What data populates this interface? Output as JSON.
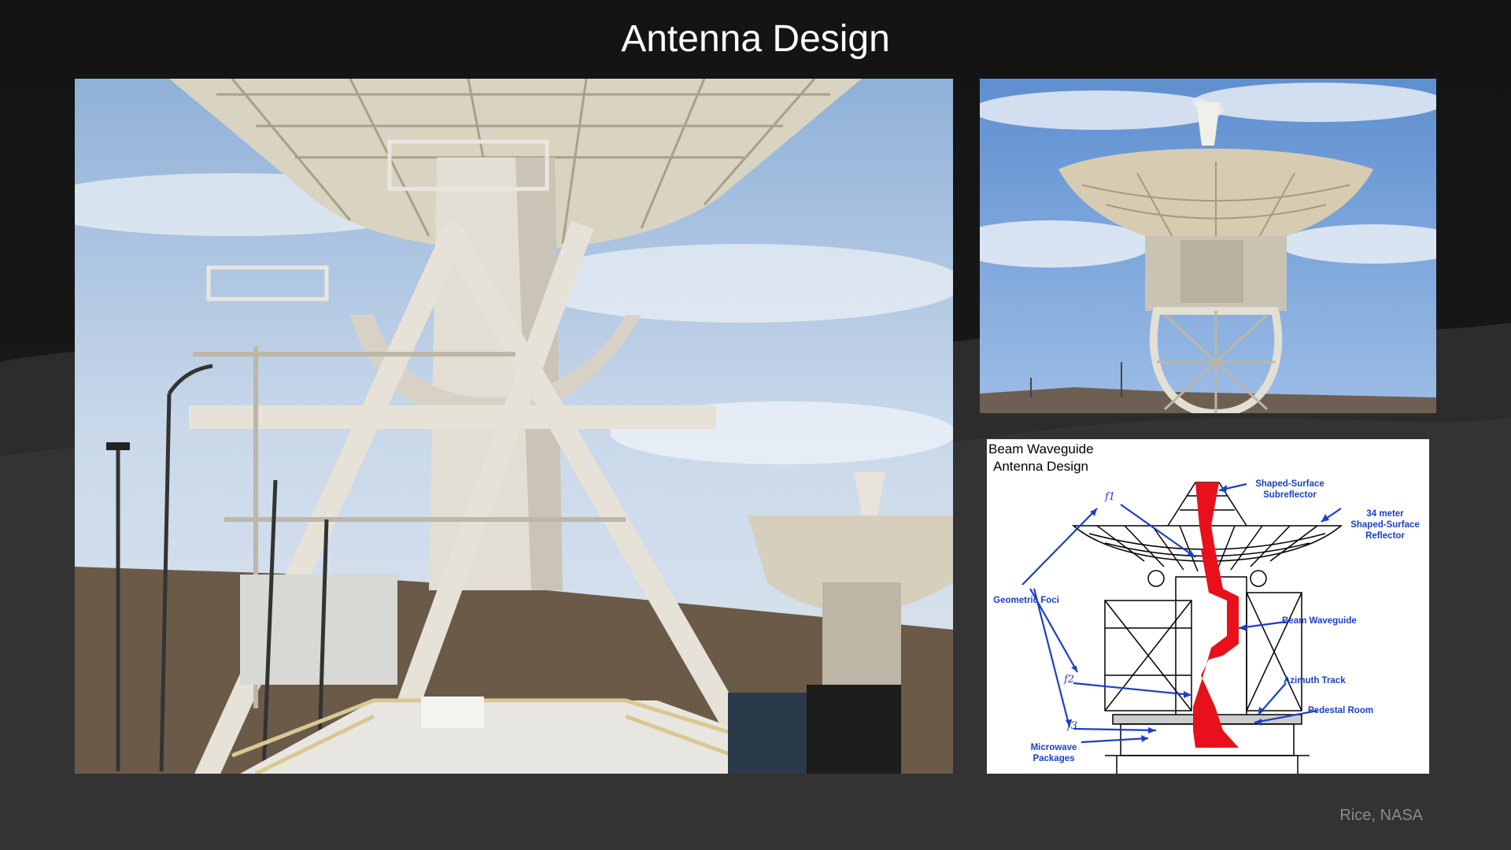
{
  "slide": {
    "title": "Antenna Design",
    "credit": "Rice, NASA"
  },
  "diagram": {
    "title_line1": "Beam Waveguide",
    "title_line2": "Antenna Design",
    "labels": {
      "subreflector_line1": "Shaped-Surface",
      "subreflector_line2": "Subreflector",
      "reflector_line1": "34 meter",
      "reflector_line2": "Shaped-Surface",
      "reflector_line3": "Reflector",
      "geometric_foci": "Geometric Foci",
      "beam_waveguide": "Beam Waveguide",
      "azimuth_track": "Azimuth Track",
      "pedestal_room": "Pedestal Room",
      "microwave_line1": "Microwave",
      "microwave_line2": "Packages",
      "f1": "f1",
      "f2": "f2",
      "f3": "f3"
    }
  },
  "colors": {
    "label_blue": "#1b3fc4",
    "beam_red": "#e8101a"
  }
}
